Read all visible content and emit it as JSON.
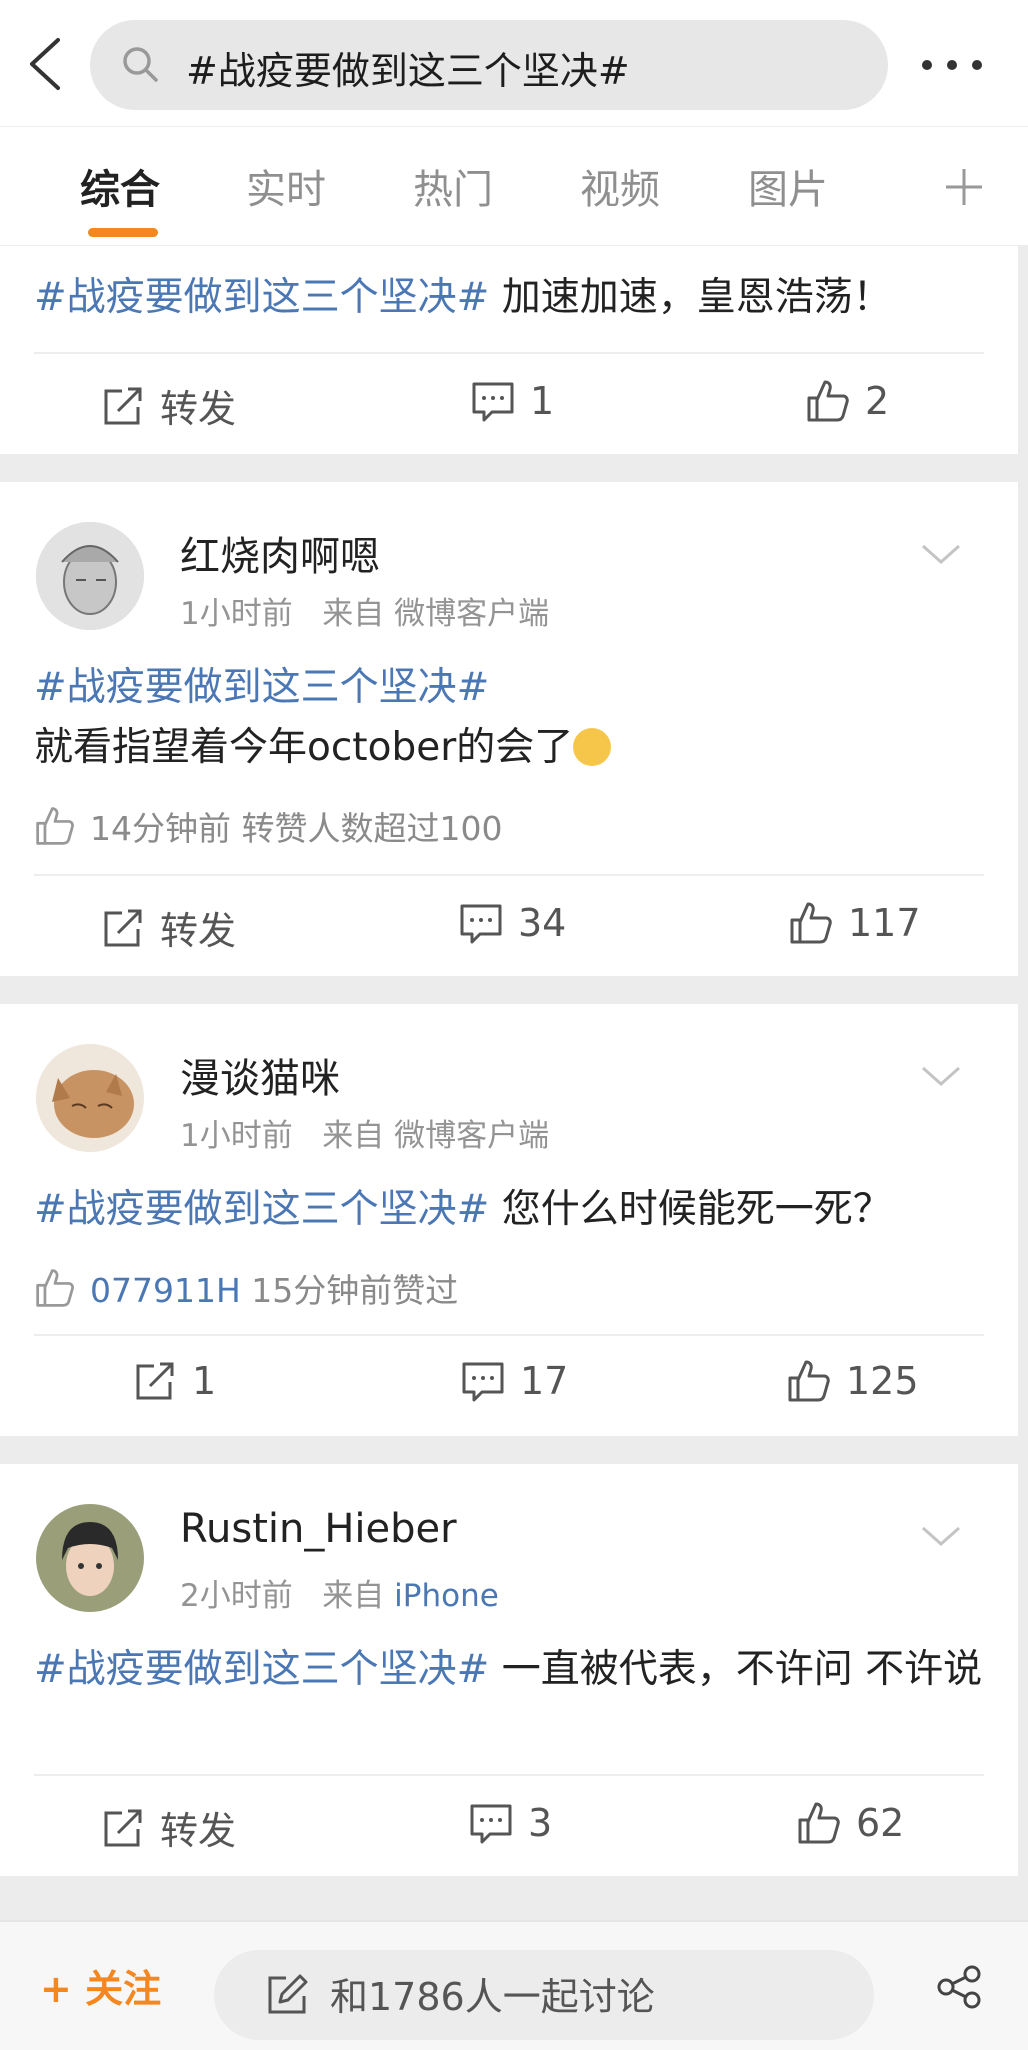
{
  "search": {
    "query": "#战疫要做到这三个坚决#"
  },
  "tabs": [
    {
      "label": "综合"
    },
    {
      "label": "实时"
    },
    {
      "label": "热门"
    },
    {
      "label": "视频"
    },
    {
      "label": "图片"
    }
  ],
  "post0": {
    "tag": "#战疫要做到这三个坚决#",
    "text": "加速加速，皇恩浩荡！",
    "repost_label": "转发",
    "comments": "1",
    "likes": "2"
  },
  "post1": {
    "author": "红烧肉啊嗯",
    "time": "1小时前",
    "source_prefix": "来自",
    "source": "微博客户端",
    "tag": "#战疫要做到这三个坚决#",
    "text": "就看指望着今年october的会了",
    "like_info": "14分钟前 转赞人数超过100",
    "repost_label": "转发",
    "comments": "34",
    "likes": "117"
  },
  "post2": {
    "author": "漫谈猫咪",
    "time": "1小时前",
    "source_prefix": "来自",
    "source": "微博客户端",
    "tag": "#战疫要做到这三个坚决#",
    "text": "您什么时候能死一死？",
    "liker": "077911H",
    "like_info": "15分钟前赞过",
    "reposts": "1",
    "comments": "17",
    "likes": "125"
  },
  "post3": {
    "author": "Rustin_Hieber",
    "time": "2小时前",
    "source_prefix": "来自",
    "source": "iPhone",
    "tag": "#战疫要做到这三个坚决#",
    "text": "一直被代表，不许问 不许说",
    "repost_label": "转发",
    "comments": "3",
    "likes": "62"
  },
  "bottom": {
    "follow_label": "关注",
    "discuss_label": "和1786人一起讨论"
  },
  "colors": {
    "accent": "#f58720",
    "link": "#4b78b4"
  }
}
